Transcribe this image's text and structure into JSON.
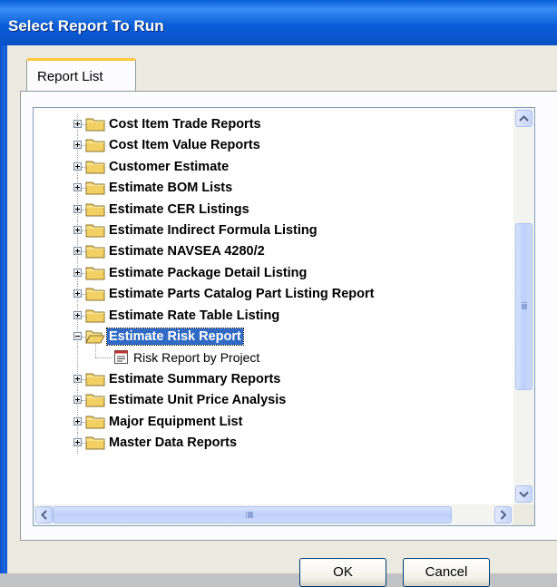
{
  "window": {
    "title": "Select Report To Run"
  },
  "tabs": [
    {
      "label": "Report List"
    }
  ],
  "tree": {
    "items": [
      {
        "label": "Cost Item Trade Reports",
        "expanded": false
      },
      {
        "label": "Cost Item Value Reports",
        "expanded": false
      },
      {
        "label": "Customer Estimate",
        "expanded": false
      },
      {
        "label": "Estimate BOM Lists",
        "expanded": false
      },
      {
        "label": "Estimate CER Listings",
        "expanded": false
      },
      {
        "label": "Estimate Indirect Formula Listing",
        "expanded": false
      },
      {
        "label": "Estimate NAVSEA 4280/2",
        "expanded": false
      },
      {
        "label": "Estimate Package Detail Listing",
        "expanded": false
      },
      {
        "label": "Estimate Parts Catalog Part Listing Report",
        "expanded": false
      },
      {
        "label": "Estimate Rate Table Listing",
        "expanded": false
      },
      {
        "label": "Estimate Risk Report",
        "expanded": true,
        "selected": true,
        "children": [
          {
            "label": "Risk Report by Project"
          }
        ]
      },
      {
        "label": "Estimate Summary Reports",
        "expanded": false
      },
      {
        "label": "Estimate Unit Price Analysis",
        "expanded": false
      },
      {
        "label": "Major Equipment List",
        "expanded": false
      },
      {
        "label": "Master Data Reports",
        "expanded": false
      }
    ]
  },
  "scroll": {
    "vertical_position": 0.33,
    "horizontal_position": 0.0
  },
  "buttons": {
    "ok_label": "OK",
    "cancel_label": "Cancel"
  },
  "colors": {
    "titlebar": "#0b5fd9",
    "selection": "#316ac5",
    "folder": "#f2d064",
    "tab_highlight": "#ffc83c"
  }
}
